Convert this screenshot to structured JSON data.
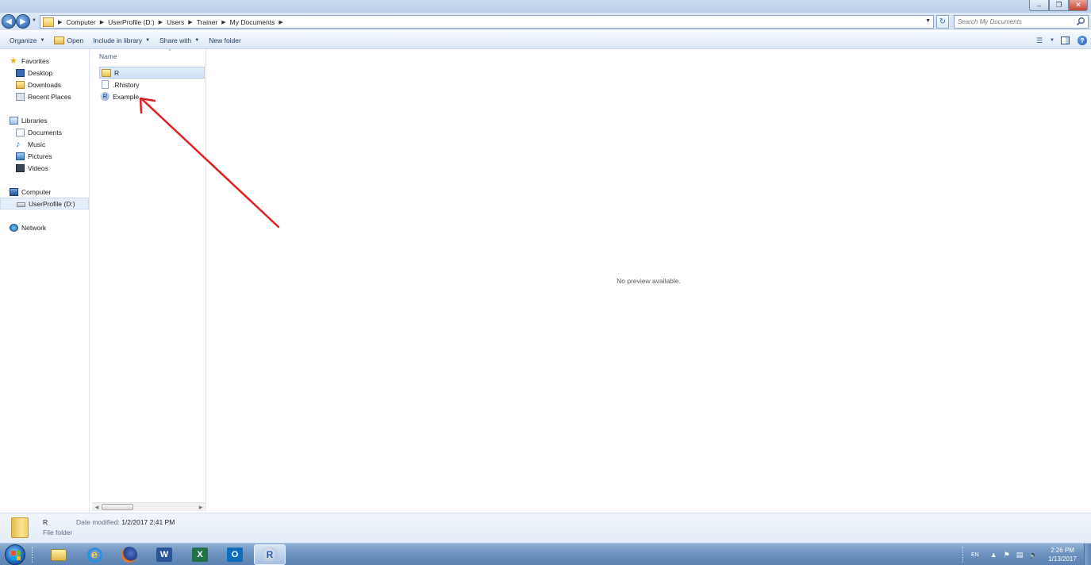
{
  "window": {
    "controls": {
      "minimize": "–",
      "restore": "❐",
      "close": "✕"
    }
  },
  "address_bar": {
    "back_icon": "back-arrow-icon",
    "forward_icon": "forward-arrow-icon",
    "breadcrumbs": [
      "Computer",
      "UserProfile (D:)",
      "Users",
      "Trainer",
      "My Documents"
    ],
    "search_placeholder": "Search My Documents"
  },
  "toolbar": {
    "organize": "Organize",
    "open": "Open",
    "include_in_library": "Include in library",
    "share_with": "Share with",
    "new_folder": "New folder"
  },
  "nav_pane": {
    "favorites": {
      "label": "Favorites",
      "items": [
        "Desktop",
        "Downloads",
        "Recent Places"
      ]
    },
    "libraries": {
      "label": "Libraries",
      "items": [
        "Documents",
        "Music",
        "Pictures",
        "Videos"
      ]
    },
    "computer": {
      "label": "Computer",
      "items": [
        "UserProfile (D:)"
      ],
      "selected": "UserProfile (D:)"
    },
    "network": {
      "label": "Network"
    }
  },
  "file_list": {
    "column_header": "Name",
    "files": [
      {
        "name": "R",
        "type": "folder",
        "selected": true
      },
      {
        "name": ".Rhistory",
        "type": "document",
        "selected": false
      },
      {
        "name": "Example",
        "type": "r-workspace",
        "selected": false
      }
    ]
  },
  "preview": {
    "message": "No preview available."
  },
  "details": {
    "name": "R",
    "type": "File folder",
    "date_modified_label": "Date modified:",
    "date_modified_value": "1/2/2017 2:41 PM"
  },
  "taskbar": {
    "apps": [
      "windows-explorer",
      "internet-explorer",
      "firefox",
      "word",
      "excel",
      "outlook",
      "r"
    ],
    "active_app": "r",
    "tray_lang": "EN",
    "clock_time": "2:26 PM",
    "clock_date": "1/13/2017"
  },
  "annotation": {
    "color": "#e02020"
  }
}
